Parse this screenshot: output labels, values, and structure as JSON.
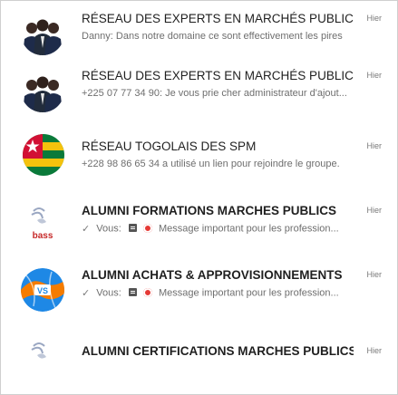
{
  "chats": [
    {
      "title": "RÉSEAU DES EXPERTS EN MARCHÉS PUBLICS &...",
      "time": "Hier",
      "sender": "Danny:",
      "message": "Dans notre domaine ce sont effectivement les pires",
      "avatar": "group-photo-avatar"
    },
    {
      "title": "RÉSEAU DES EXPERTS EN MARCHÉS PUBLICS &...",
      "time": "Hier",
      "sender": "+225 07 77 34 90:",
      "message": "Je vous prie cher administrateur d'ajout...",
      "avatar": "group-photo-avatar"
    },
    {
      "title": "RÉSEAU TOGOLAIS DES SPM",
      "time": "Hier",
      "sender": "+228 98 86 65 34",
      "message": "a utilisé un lien pour rejoindre le groupe.",
      "avatar": "togo-flag-avatar"
    },
    {
      "title": "ALUMNI FORMATIONS MARCHES PUBLICS",
      "time": "Hier",
      "sender": "Vous:",
      "message": "Message important pour les profession...",
      "avatar": "bass-logo-avatar",
      "avatar_text": "bass"
    },
    {
      "title": "ALUMNI ACHATS & APPROVISIONNEMENTS",
      "time": "Hier",
      "sender": "Vous:",
      "message": "Message important pour les profession...",
      "avatar": "globe-vs-avatar",
      "avatar_text": "VS"
    },
    {
      "title": "ALUMNI CERTIFICATIONS MARCHES PUBLICS",
      "time": "Hier",
      "avatar": "bass-logo-avatar"
    }
  ],
  "colors": {
    "title": "#1f1f1f",
    "preview": "#6e6e6e",
    "time": "#7a7a7a",
    "togo_green": "#0a7a3a",
    "togo_yellow": "#f4c20d",
    "togo_red": "#d21034",
    "bass_red": "#c62828",
    "globe_blue": "#1e88e5",
    "globe_orange": "#f57c00"
  },
  "icons": {
    "read_check": "✓",
    "document": "document-icon",
    "target": "target-icon"
  }
}
